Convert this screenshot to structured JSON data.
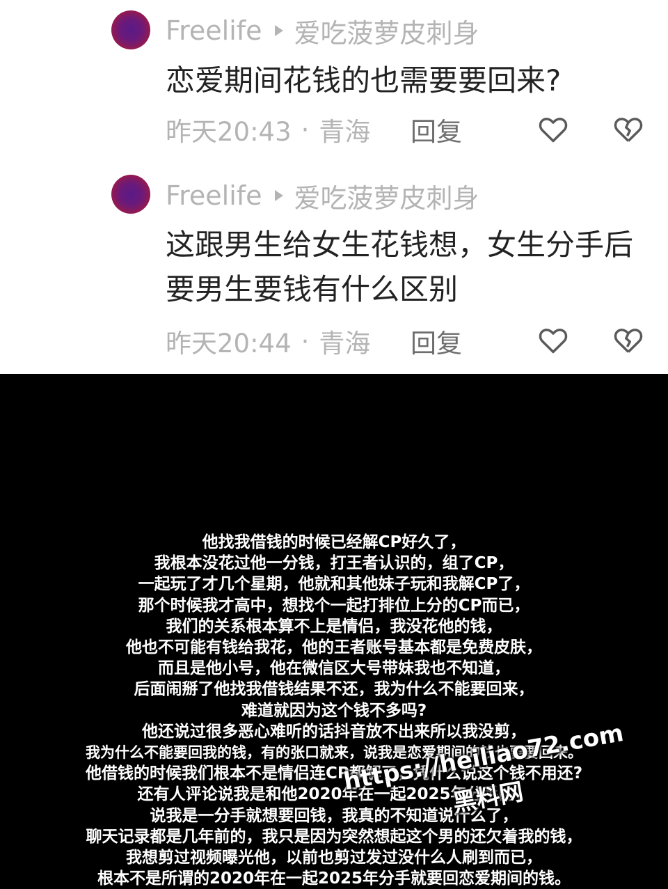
{
  "comments": [
    {
      "username": "Freelife",
      "reply_target": "爱吃菠萝皮刺身",
      "text": "恋爱期间花钱的也需要要回来?",
      "time": "昨天20:43",
      "location": "青海",
      "reply_label": "回复"
    },
    {
      "username": "Freelife",
      "reply_target": "爱吃菠萝皮刺身",
      "text": "这跟男生给女生花钱想，女生分手后要男生要钱有什么区别",
      "time": "昨天20:44",
      "location": "青海",
      "reply_label": "回复"
    }
  ],
  "separator": "·",
  "icons": {
    "avatar": "avatar-image",
    "like": "heart-outline-icon",
    "dislike": "broken-heart-icon",
    "reply_arrow": "play-triangle-icon"
  },
  "colors": {
    "meta_gray": "#b4b4b4",
    "text_dark": "#222222",
    "subtitle_bg": "#000000",
    "subtitle_text": "#ffffff"
  },
  "subtitle_lines": [
    "他找我借钱的时候已经解CP好久了，",
    "我根本没花过他一分钱，打王者认识的，组了CP，",
    "一起玩了才几个星期，他就和其他妹子玩和我解CP了，",
    "那个时候我才高中，想找个一起打排位上分的CP而已，",
    "我们的关系根本算不上是情侣，我没花他的钱，",
    "他也不可能有钱给我花，他的王者账号基本都是免费皮肤，",
    "而且是他小号，他在微信区大号带妹我也不知道，",
    "后面闹掰了他找我借钱结果不还，我为什么不能要回来，",
    "难道就因为这个钱不多吗?",
    "他还说过很多恶心难听的话抖音放不出来所以我没剪，",
    "我为什么不能要回我的钱，有的张口就来，说我是恋爱期间的钱也要要回来。",
    "他借钱的时候我们根本不是情侣连CP都解了，凭什么说这个钱不用还?",
    "还有人评论说我是和他2020年在一起2025年分手的，",
    "说我是一分手就想要回钱，我真的不知道说什么了，",
    "聊天记录都是几年前的，我只是因为突然想起这个男的还欠着我的钱，",
    "我想剪过视频曝光他，以前也剪过发过没什么人刷到而已，",
    "根本不是所谓的2020年在一起2025年分手就要回恋爱期间的钱。"
  ],
  "watermark": {
    "url": "https://heiliao72.com",
    "brand": "黑料网"
  }
}
